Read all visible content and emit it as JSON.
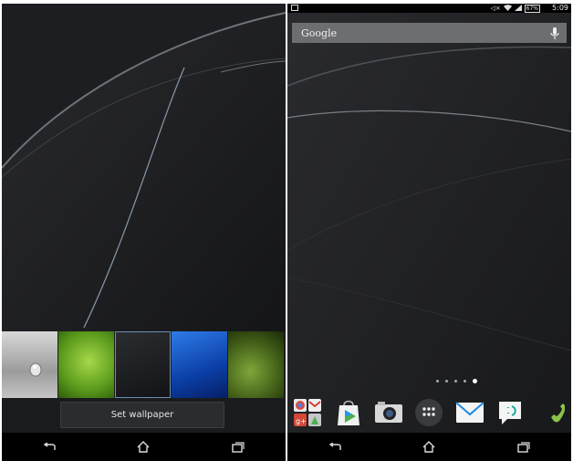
{
  "left_screen": {
    "wallpaper_thumbs": [
      {
        "name": "metal-drop",
        "selected": false
      },
      {
        "name": "green-leaf",
        "selected": false
      },
      {
        "name": "dark-waves",
        "selected": true
      },
      {
        "name": "blue-waves",
        "selected": false
      },
      {
        "name": "olive-leaf",
        "selected": false
      }
    ],
    "set_wallpaper_label": "Set wallpaper",
    "nav": [
      "back-icon",
      "home-icon",
      "recent-apps-icon"
    ]
  },
  "right_screen": {
    "status": {
      "battery": "67%",
      "time": "5:09",
      "icons": [
        "mute-icon",
        "wifi-icon",
        "signal-icon",
        "battery-icon"
      ]
    },
    "search": {
      "label": "Google",
      "icon": "mic-icon"
    },
    "page_dots": {
      "count": 5,
      "active_index": 4
    },
    "dock_apps": [
      "google-apps-folder-icon",
      "play-store-icon",
      "camera-icon",
      "app-drawer-icon",
      "email-icon",
      "messaging-icon",
      "phone-icon"
    ],
    "nav": [
      "back-icon",
      "home-icon",
      "recent-apps-icon"
    ]
  },
  "colors": {
    "background": "#1a1b1d",
    "navbar": "#000000",
    "search_bar": "#6d6e72"
  }
}
